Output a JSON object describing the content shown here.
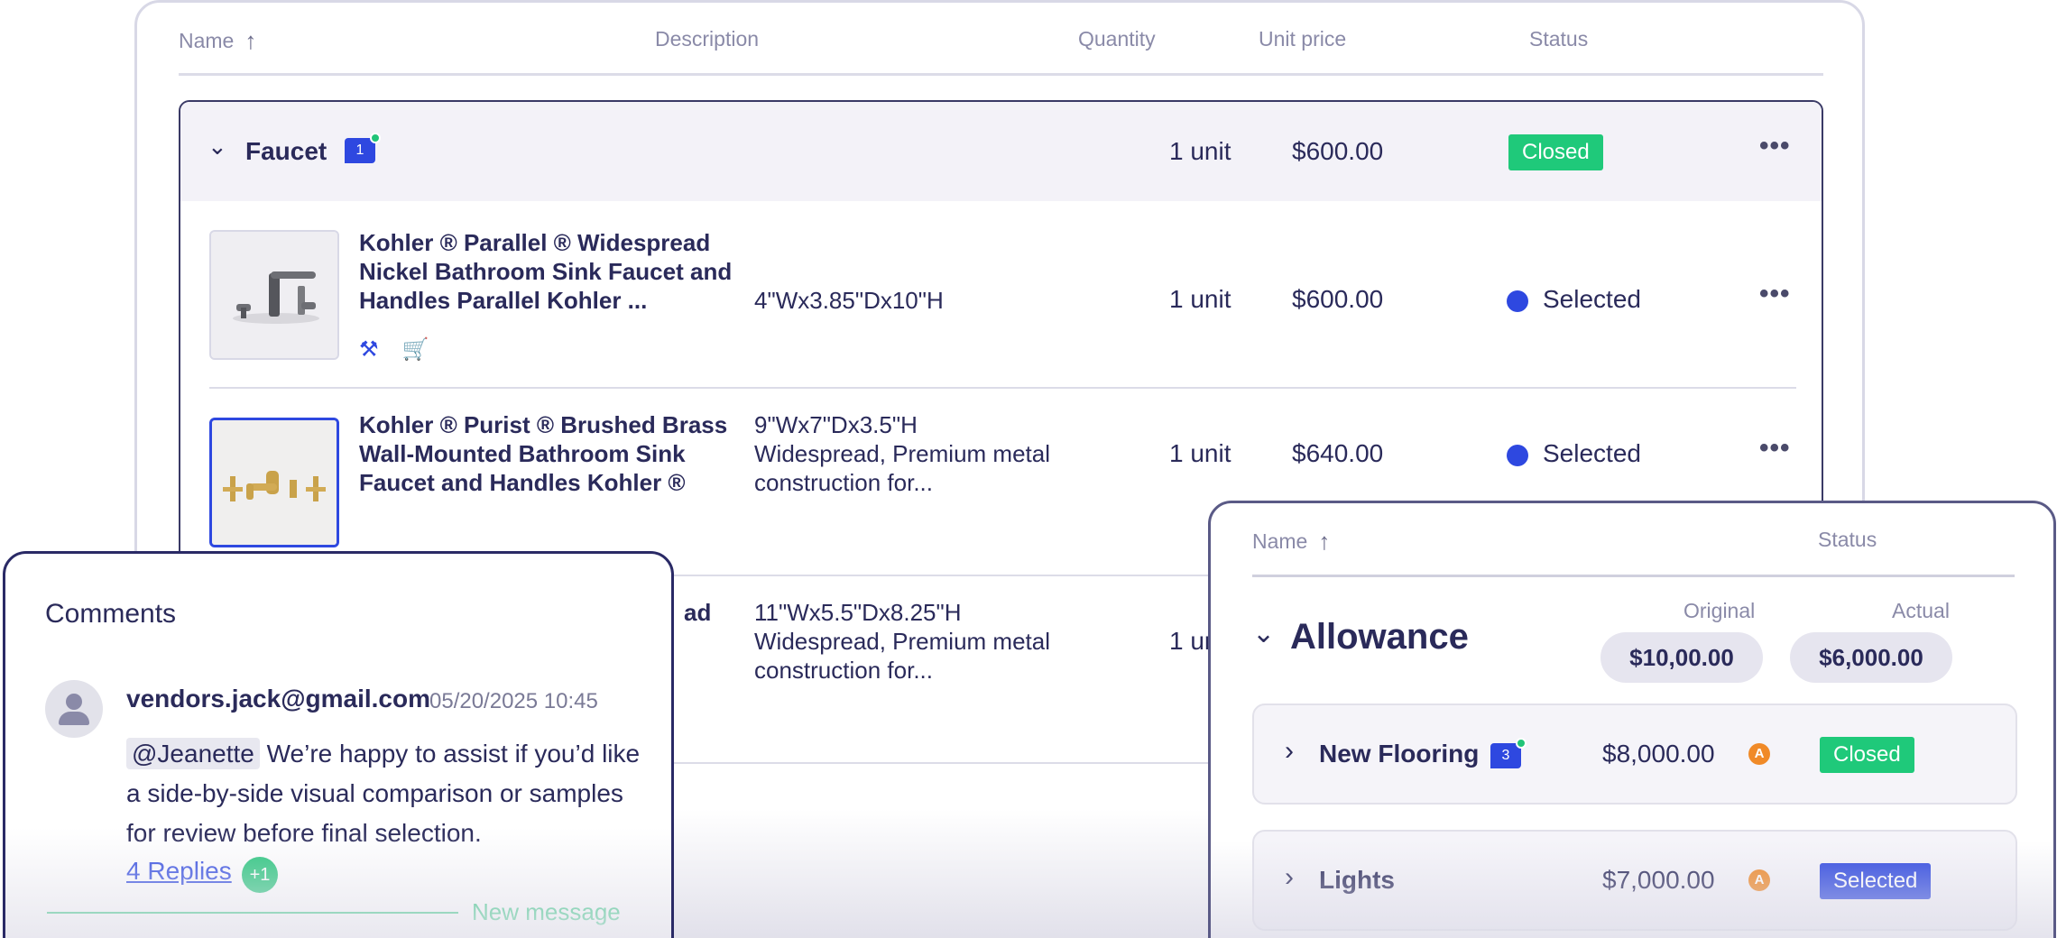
{
  "table": {
    "headers": {
      "name": "Name",
      "description": "Description",
      "quantity": "Quantity",
      "unit_price": "Unit price",
      "status": "Status"
    },
    "group": {
      "title": "Faucet",
      "comment_count": "1",
      "quantity": "1 unit",
      "price": "$600.00",
      "status": "Closed"
    },
    "rows": [
      {
        "name": "Kohler ® Parallel ® Widespread Nickel Bathroom Sink Faucet and Handles Parallel Kohler ...",
        "description": "4\"Wx3.85\"Dx10\"H",
        "quantity": "1 unit",
        "price": "$600.00",
        "status": "Selected"
      },
      {
        "name": "Kohler ® Purist ® Brushed Brass Wall-Mounted Bathroom Sink Faucet and Handles Kohler ®",
        "description": "9\"Wx7\"Dx3.5\"H Widespread, Premium metal construction for...",
        "quantity": "1 unit",
        "price": "$640.00",
        "status": "Selected"
      },
      {
        "name_fragment": "ad",
        "description": "11\"Wx5.5\"Dx8.25\"H Widespread, Premium metal construction for...",
        "quantity_fragment": "1 ur"
      }
    ]
  },
  "comments": {
    "title": "Comments",
    "author": "vendors.jack@gmail.com",
    "timestamp": "05/20/2025 10:45",
    "mention": "@Jeanette",
    "body": "We’re happy to assist if you’d like a side-by-side visual comparison or samples for review before final selection.",
    "replies": "4 Replies",
    "new_replies": "+1",
    "new_message": "New message"
  },
  "allowance": {
    "headers": {
      "name": "Name",
      "status": "Status"
    },
    "title": "Allowance",
    "original_label": "Original",
    "actual_label": "Actual",
    "original": "$10,00.00",
    "actual": "$6,000.00",
    "items": [
      {
        "name": "New Flooring",
        "comment_count": "3",
        "amount": "$8,000.00",
        "badge": "A",
        "status": "Closed"
      },
      {
        "name": "Lights",
        "amount": "$7,000.00",
        "badge": "A",
        "status": "Selected"
      }
    ]
  },
  "colors": {
    "accent": "#2e48e0",
    "success": "#1fc97a",
    "warning": "#f08a28",
    "ink": "#2a2a5a"
  }
}
